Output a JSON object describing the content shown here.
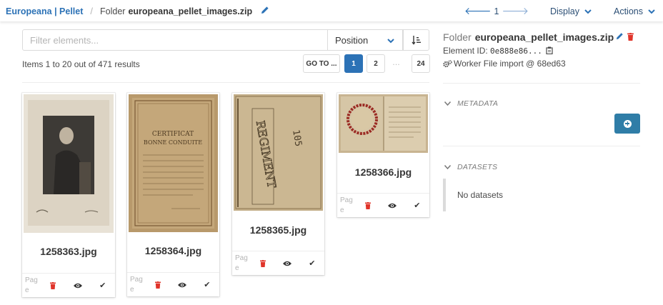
{
  "breadcrumb": {
    "project": "Europeana | Pellet",
    "separator": "/",
    "element_type": "Folder",
    "element_name": "europeana_pellet_images.zip"
  },
  "navbar": {
    "position": "1",
    "display_label": "Display",
    "actions_label": "Actions"
  },
  "filter": {
    "placeholder": "Filter elements..."
  },
  "sort": {
    "selected": "Position"
  },
  "results": {
    "summary": "Items 1 to 20 out of 471 results"
  },
  "pagination": {
    "goto_label": "GO TO ...",
    "pages": [
      "1",
      "2"
    ],
    "current": "1",
    "ellipsis": "…",
    "last": "24"
  },
  "cards": [
    {
      "name": "1258363.jpg",
      "page_label": "Page",
      "thumb_color": "#e2dbcf"
    },
    {
      "name": "1258364.jpg",
      "page_label": "Page",
      "thumb_color": "#b8996b"
    },
    {
      "name": "1258365.jpg",
      "page_label": "Page",
      "thumb_color": "#c2ad87"
    },
    {
      "name": "1258366.jpg",
      "page_label": "Page",
      "thumb_color": "#c8b491"
    }
  ],
  "details": {
    "element_type": "Folder",
    "element_name": "europeana_pellet_images.zip",
    "element_id_label": "Element ID:",
    "element_id": "0e888e86...",
    "worker": "Worker File import @ 68ed63",
    "metadata_label": "METADATA",
    "datasets_label": "DATASETS",
    "datasets_empty": "No datasets"
  },
  "colors": {
    "primary": "#2c72b6",
    "info": "#2f7da7",
    "danger": "#e0342a"
  }
}
